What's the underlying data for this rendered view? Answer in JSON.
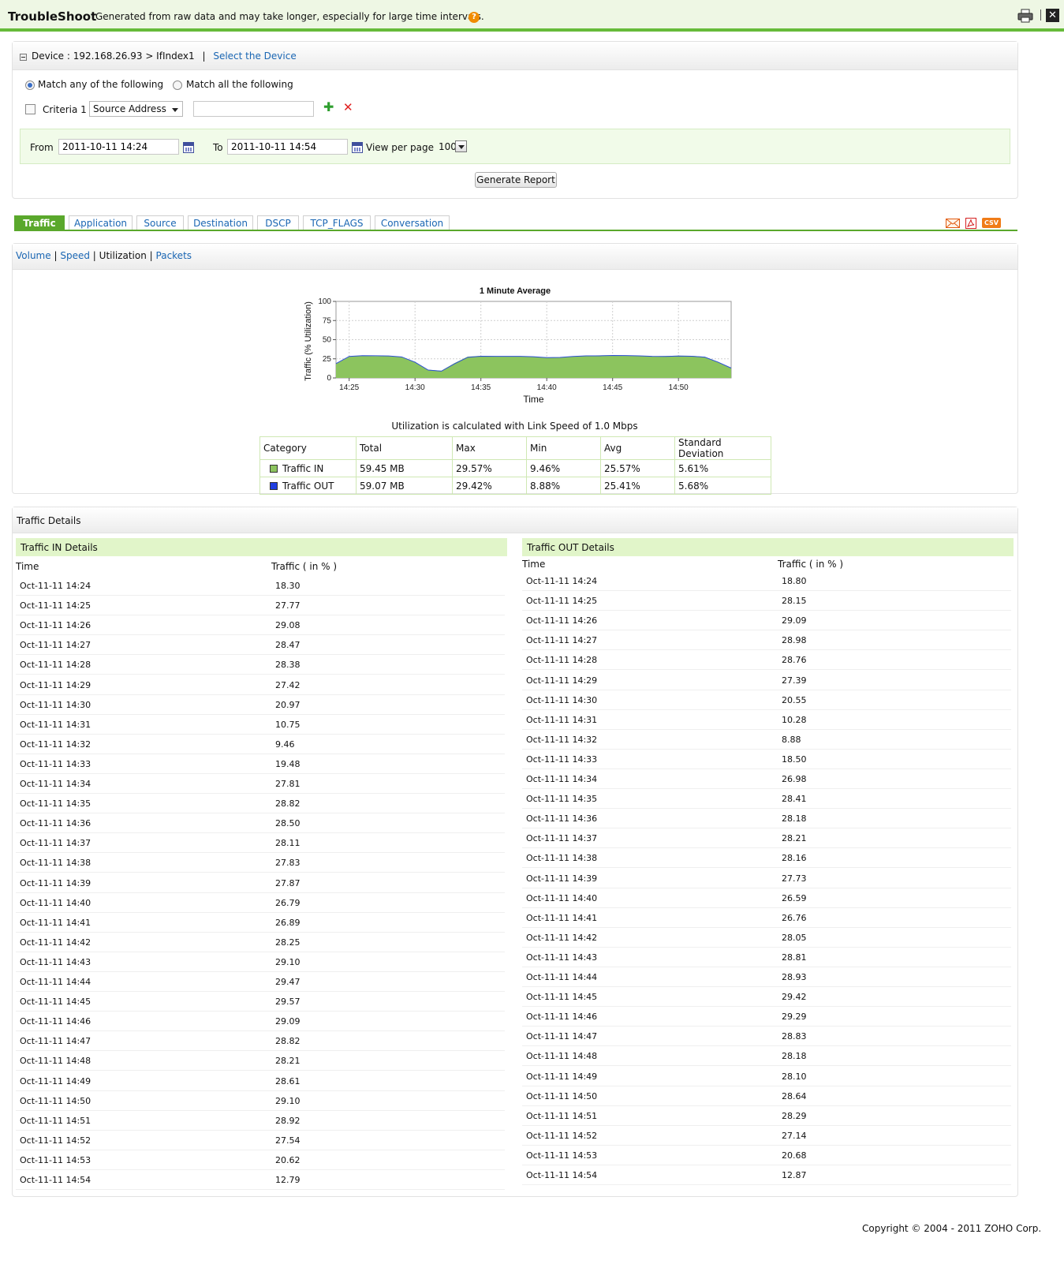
{
  "header": {
    "title": "TroubleShoot",
    "subtitle": "Generated from raw data and may take longer, especially for large time intervals.",
    "help_icon": "question-icon",
    "print_icon": "print-icon",
    "close_icon": "close-icon"
  },
  "criteria": {
    "device_label": "Device : 192.168.26.93 > IfIndex1",
    "separator": "|",
    "select_device_link": "Select the Device",
    "match_any_label": "Match any of the following",
    "match_all_label": "Match all the following",
    "selected_match": "any",
    "criteria_label": "Criteria 1",
    "criteria_field": "Source Address",
    "criteria_value": "",
    "from_label": "From",
    "from_value": "2011-10-11 14:24",
    "to_label": "To",
    "to_value": "2011-10-11 14:54",
    "view_per_page_label": "View per page",
    "view_per_page_value": "100",
    "generate_button": "Generate Report"
  },
  "tabs": [
    {
      "label": "Traffic",
      "active": true
    },
    {
      "label": "Application",
      "active": false
    },
    {
      "label": "Source",
      "active": false
    },
    {
      "label": "Destination",
      "active": false
    },
    {
      "label": "DSCP",
      "active": false
    },
    {
      "label": "TCP_FLAGS",
      "active": false
    },
    {
      "label": "Conversation",
      "active": false
    }
  ],
  "export_icons": [
    "email-icon",
    "pdf-icon",
    "csv-icon"
  ],
  "export_csv_label": "CSV",
  "subnav": {
    "volume": "Volume",
    "speed": "Speed",
    "utilization": "Utilization",
    "packets": "Packets",
    "sep": "|"
  },
  "chart_data": {
    "type": "area",
    "title": "1 Minute Average",
    "xlabel": "Time",
    "ylabel": "Traffic (% Utilization)",
    "ylim": [
      0,
      100
    ],
    "yticks": [
      "0",
      "25",
      "50",
      "75",
      "100"
    ],
    "xticks": [
      "14:25",
      "14:30",
      "14:35",
      "14:40",
      "14:45",
      "14:50"
    ],
    "grid": true,
    "x": [
      "14:24",
      "14:25",
      "14:26",
      "14:27",
      "14:28",
      "14:29",
      "14:30",
      "14:31",
      "14:32",
      "14:33",
      "14:34",
      "14:35",
      "14:36",
      "14:37",
      "14:38",
      "14:39",
      "14:40",
      "14:41",
      "14:42",
      "14:43",
      "14:44",
      "14:45",
      "14:46",
      "14:47",
      "14:48",
      "14:49",
      "14:50",
      "14:51",
      "14:52",
      "14:53",
      "14:54"
    ],
    "series": [
      {
        "name": "Traffic IN",
        "color": "#8cc45e",
        "values": [
          18.3,
          27.77,
          29.08,
          28.47,
          28.38,
          27.42,
          20.97,
          10.75,
          9.46,
          19.48,
          27.81,
          28.82,
          28.5,
          28.11,
          27.83,
          27.87,
          26.79,
          26.89,
          28.25,
          29.1,
          29.47,
          29.57,
          29.09,
          28.82,
          28.21,
          28.61,
          29.1,
          28.92,
          27.54,
          20.62,
          12.79
        ]
      },
      {
        "name": "Traffic OUT",
        "color": "#2b4fd6",
        "values": [
          18.8,
          28.15,
          29.09,
          28.98,
          28.76,
          27.39,
          20.55,
          10.28,
          8.88,
          18.5,
          26.98,
          28.41,
          28.18,
          28.21,
          28.16,
          27.73,
          26.59,
          26.76,
          28.05,
          28.81,
          28.93,
          29.42,
          29.29,
          28.83,
          28.18,
          28.1,
          28.64,
          28.29,
          27.14,
          20.68,
          12.87
        ]
      }
    ]
  },
  "util_note": "Utilization is calculated with Link Speed of 1.0 Mbps",
  "summary": {
    "headers": [
      "Category",
      "Total",
      "Max",
      "Min",
      "Avg",
      "Standard Deviation"
    ],
    "rows": [
      {
        "category": "Traffic IN",
        "color": "#8cc45e",
        "total": "59.45 MB",
        "max": "29.57%",
        "min": "9.46%",
        "avg": "25.57%",
        "sd": "5.61%"
      },
      {
        "category": "Traffic OUT",
        "color": "#1f3ee0",
        "total": "59.07 MB",
        "max": "29.42%",
        "min": "8.88%",
        "avg": "25.41%",
        "sd": "5.68%"
      }
    ]
  },
  "details": {
    "title": "Traffic Details",
    "in_title": "Traffic IN Details",
    "out_title": "Traffic OUT Details",
    "col_time": "Time",
    "col_traffic": "Traffic ( in % )",
    "times": [
      "Oct-11-11 14:24",
      "Oct-11-11 14:25",
      "Oct-11-11 14:26",
      "Oct-11-11 14:27",
      "Oct-11-11 14:28",
      "Oct-11-11 14:29",
      "Oct-11-11 14:30",
      "Oct-11-11 14:31",
      "Oct-11-11 14:32",
      "Oct-11-11 14:33",
      "Oct-11-11 14:34",
      "Oct-11-11 14:35",
      "Oct-11-11 14:36",
      "Oct-11-11 14:37",
      "Oct-11-11 14:38",
      "Oct-11-11 14:39",
      "Oct-11-11 14:40",
      "Oct-11-11 14:41",
      "Oct-11-11 14:42",
      "Oct-11-11 14:43",
      "Oct-11-11 14:44",
      "Oct-11-11 14:45",
      "Oct-11-11 14:46",
      "Oct-11-11 14:47",
      "Oct-11-11 14:48",
      "Oct-11-11 14:49",
      "Oct-11-11 14:50",
      "Oct-11-11 14:51",
      "Oct-11-11 14:52",
      "Oct-11-11 14:53",
      "Oct-11-11 14:54"
    ],
    "in_values": [
      "18.30",
      "27.77",
      "29.08",
      "28.47",
      "28.38",
      "27.42",
      "20.97",
      "10.75",
      "9.46",
      "19.48",
      "27.81",
      "28.82",
      "28.50",
      "28.11",
      "27.83",
      "27.87",
      "26.79",
      "26.89",
      "28.25",
      "29.10",
      "29.47",
      "29.57",
      "29.09",
      "28.82",
      "28.21",
      "28.61",
      "29.10",
      "28.92",
      "27.54",
      "20.62",
      "12.79"
    ],
    "out_values": [
      "18.80",
      "28.15",
      "29.09",
      "28.98",
      "28.76",
      "27.39",
      "20.55",
      "10.28",
      "8.88",
      "18.50",
      "26.98",
      "28.41",
      "28.18",
      "28.21",
      "28.16",
      "27.73",
      "26.59",
      "26.76",
      "28.05",
      "28.81",
      "28.93",
      "29.42",
      "29.29",
      "28.83",
      "28.18",
      "28.10",
      "28.64",
      "28.29",
      "27.14",
      "20.68",
      "12.87"
    ]
  },
  "footer": "Copyright © 2004 - 2011 ZOHO Corp."
}
